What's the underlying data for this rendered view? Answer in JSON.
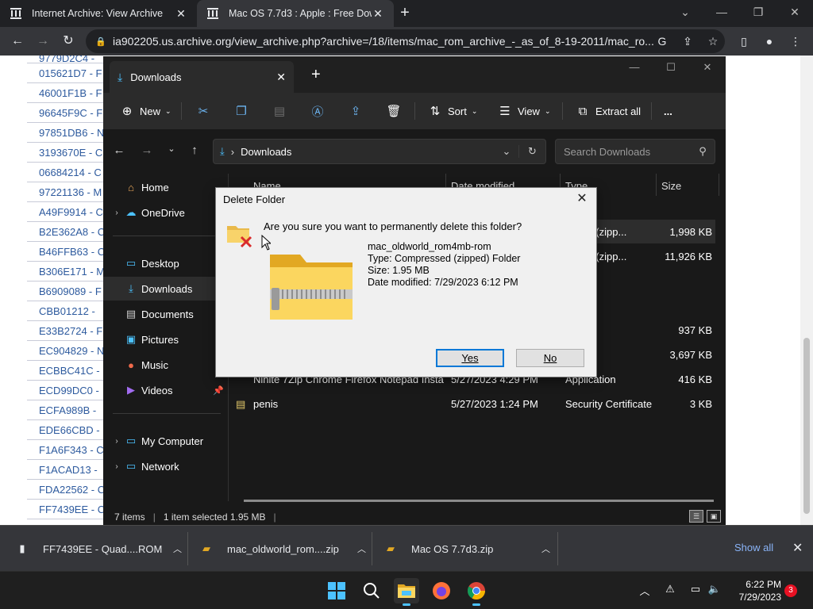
{
  "browser": {
    "tabs": [
      {
        "title": "Internet Archive: View Archive"
      },
      {
        "title": "Mac OS 7.7d3 : Apple : Free Dow"
      }
    ],
    "url": "ia902205.us.archive.org/view_archive.php?archive=/18/items/mac_rom_archive_-_as_of_8-19-2011/mac_ro..."
  },
  "archive_list": [
    "9779D2C4 -",
    "015621D7 - F",
    "46001F1B - F",
    "96645F9C - F",
    "97851DB6 - N",
    "3193670E - C",
    "06684214 - C",
    "97221136 - M",
    "A49F9914 - C",
    "B2E362A8 - C",
    "B46FFB63 - C",
    "B306E171 - M",
    "B6909089 - F",
    "CBB01212 -",
    "E33B2724 - F",
    "EC904829 - N",
    "ECBBC41C -",
    "ECD99DC0 -",
    "ECFA989B -",
    "EDE66CBD -",
    "F1A6F343 - C",
    "F1ACAD13 -",
    "FDA22562 - C",
    "FF7439EE - C"
  ],
  "explorer": {
    "tab_title": "Downloads",
    "toolbar": {
      "new": "New",
      "sort": "Sort",
      "view": "View",
      "extract_all": "Extract all",
      "more": "..."
    },
    "address": "Downloads",
    "search_placeholder": "Search Downloads",
    "nav": {
      "home": "Home",
      "onedrive": "OneDrive",
      "desktop": "Desktop",
      "downloads": "Downloads",
      "documents": "Documents",
      "pictures": "Pictures",
      "music": "Music",
      "videos": "Videos",
      "my_computer": "My Computer",
      "network": "Network"
    },
    "columns": {
      "name": "Name",
      "date": "Date modified",
      "type": "Type",
      "size": "Size"
    },
    "rows": [
      {
        "name": "",
        "date": "",
        "type": "essed (zipp...",
        "size": "1,998 KB"
      },
      {
        "name": "",
        "date": "",
        "type": "essed (zipp...",
        "size": "11,926 KB"
      },
      {
        "name": "",
        "date": "",
        "type": "der",
        "size": ""
      },
      {
        "name": "",
        "date": "",
        "type": "ation",
        "size": "937 KB"
      },
      {
        "name": "",
        "date": "",
        "type": "ation",
        "size": "3,697 KB"
      },
      {
        "name": "Ninite 7Zip Chrome Firefox Notepad Insta...",
        "date": "5/27/2023 4:29 PM",
        "type": "Application",
        "size": "416 KB"
      },
      {
        "name": "penis",
        "date": "5/27/2023 1:24 PM",
        "type": "Security Certificate",
        "size": "3 KB"
      }
    ],
    "status": {
      "items": "7 items",
      "selected": "1 item selected  1.95 MB"
    }
  },
  "dialog": {
    "title": "Delete Folder",
    "message": "Are you sure you want to permanently delete this folder?",
    "filename": "mac_oldworld_rom4mb-rom",
    "type": "Type: Compressed (zipped) Folder",
    "size": "Size: 1.95 MB",
    "date": "Date modified: 7/29/2023 6:12 PM",
    "yes": "Yes",
    "no": "No"
  },
  "downloads_bar": {
    "items": [
      {
        "name": "FF7439EE - Quad....ROM"
      },
      {
        "name": "mac_oldworld_rom....zip"
      },
      {
        "name": "Mac OS 7.7d3.zip"
      }
    ],
    "show_all": "Show all"
  },
  "taskbar": {
    "time": "6:22 PM",
    "date": "7/29/2023",
    "notifications": "3"
  }
}
